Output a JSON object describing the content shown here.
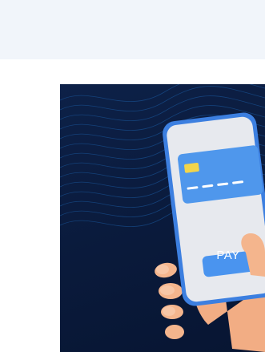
{
  "hero": {
    "pay_label": "PAY",
    "colors": {
      "top_band": "#f1f5fa",
      "card_background": "#0a1a3b",
      "wave_lines": "#1b5fa8",
      "phone_body": "#e7e9ee",
      "phone_frame": "#3c7fe0",
      "payment_card": "#4f97ec",
      "card_chip": "#f2d54b",
      "pay_button": "#4a94ef",
      "hand": "#f4b58d"
    },
    "icons": [
      "smartphone-icon",
      "credit-card-icon",
      "hand-icon"
    ]
  }
}
